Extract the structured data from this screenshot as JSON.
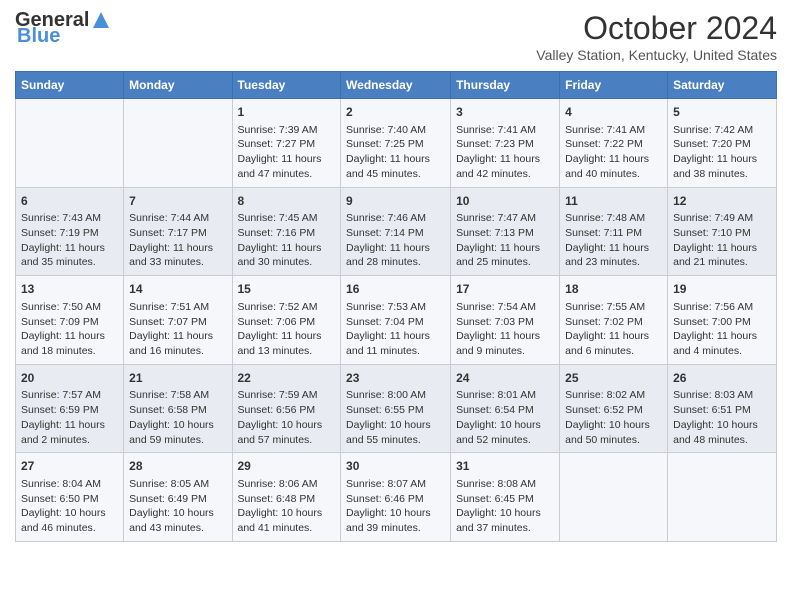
{
  "logo": {
    "part1": "General",
    "part2": "Blue"
  },
  "title": "October 2024",
  "subtitle": "Valley Station, Kentucky, United States",
  "days_of_week": [
    "Sunday",
    "Monday",
    "Tuesday",
    "Wednesday",
    "Thursday",
    "Friday",
    "Saturday"
  ],
  "weeks": [
    [
      {
        "day": "",
        "content": ""
      },
      {
        "day": "",
        "content": ""
      },
      {
        "day": "1",
        "content": "Sunrise: 7:39 AM\nSunset: 7:27 PM\nDaylight: 11 hours and 47 minutes."
      },
      {
        "day": "2",
        "content": "Sunrise: 7:40 AM\nSunset: 7:25 PM\nDaylight: 11 hours and 45 minutes."
      },
      {
        "day": "3",
        "content": "Sunrise: 7:41 AM\nSunset: 7:23 PM\nDaylight: 11 hours and 42 minutes."
      },
      {
        "day": "4",
        "content": "Sunrise: 7:41 AM\nSunset: 7:22 PM\nDaylight: 11 hours and 40 minutes."
      },
      {
        "day": "5",
        "content": "Sunrise: 7:42 AM\nSunset: 7:20 PM\nDaylight: 11 hours and 38 minutes."
      }
    ],
    [
      {
        "day": "6",
        "content": "Sunrise: 7:43 AM\nSunset: 7:19 PM\nDaylight: 11 hours and 35 minutes."
      },
      {
        "day": "7",
        "content": "Sunrise: 7:44 AM\nSunset: 7:17 PM\nDaylight: 11 hours and 33 minutes."
      },
      {
        "day": "8",
        "content": "Sunrise: 7:45 AM\nSunset: 7:16 PM\nDaylight: 11 hours and 30 minutes."
      },
      {
        "day": "9",
        "content": "Sunrise: 7:46 AM\nSunset: 7:14 PM\nDaylight: 11 hours and 28 minutes."
      },
      {
        "day": "10",
        "content": "Sunrise: 7:47 AM\nSunset: 7:13 PM\nDaylight: 11 hours and 25 minutes."
      },
      {
        "day": "11",
        "content": "Sunrise: 7:48 AM\nSunset: 7:11 PM\nDaylight: 11 hours and 23 minutes."
      },
      {
        "day": "12",
        "content": "Sunrise: 7:49 AM\nSunset: 7:10 PM\nDaylight: 11 hours and 21 minutes."
      }
    ],
    [
      {
        "day": "13",
        "content": "Sunrise: 7:50 AM\nSunset: 7:09 PM\nDaylight: 11 hours and 18 minutes."
      },
      {
        "day": "14",
        "content": "Sunrise: 7:51 AM\nSunset: 7:07 PM\nDaylight: 11 hours and 16 minutes."
      },
      {
        "day": "15",
        "content": "Sunrise: 7:52 AM\nSunset: 7:06 PM\nDaylight: 11 hours and 13 minutes."
      },
      {
        "day": "16",
        "content": "Sunrise: 7:53 AM\nSunset: 7:04 PM\nDaylight: 11 hours and 11 minutes."
      },
      {
        "day": "17",
        "content": "Sunrise: 7:54 AM\nSunset: 7:03 PM\nDaylight: 11 hours and 9 minutes."
      },
      {
        "day": "18",
        "content": "Sunrise: 7:55 AM\nSunset: 7:02 PM\nDaylight: 11 hours and 6 minutes."
      },
      {
        "day": "19",
        "content": "Sunrise: 7:56 AM\nSunset: 7:00 PM\nDaylight: 11 hours and 4 minutes."
      }
    ],
    [
      {
        "day": "20",
        "content": "Sunrise: 7:57 AM\nSunset: 6:59 PM\nDaylight: 11 hours and 2 minutes."
      },
      {
        "day": "21",
        "content": "Sunrise: 7:58 AM\nSunset: 6:58 PM\nDaylight: 10 hours and 59 minutes."
      },
      {
        "day": "22",
        "content": "Sunrise: 7:59 AM\nSunset: 6:56 PM\nDaylight: 10 hours and 57 minutes."
      },
      {
        "day": "23",
        "content": "Sunrise: 8:00 AM\nSunset: 6:55 PM\nDaylight: 10 hours and 55 minutes."
      },
      {
        "day": "24",
        "content": "Sunrise: 8:01 AM\nSunset: 6:54 PM\nDaylight: 10 hours and 52 minutes."
      },
      {
        "day": "25",
        "content": "Sunrise: 8:02 AM\nSunset: 6:52 PM\nDaylight: 10 hours and 50 minutes."
      },
      {
        "day": "26",
        "content": "Sunrise: 8:03 AM\nSunset: 6:51 PM\nDaylight: 10 hours and 48 minutes."
      }
    ],
    [
      {
        "day": "27",
        "content": "Sunrise: 8:04 AM\nSunset: 6:50 PM\nDaylight: 10 hours and 46 minutes."
      },
      {
        "day": "28",
        "content": "Sunrise: 8:05 AM\nSunset: 6:49 PM\nDaylight: 10 hours and 43 minutes."
      },
      {
        "day": "29",
        "content": "Sunrise: 8:06 AM\nSunset: 6:48 PM\nDaylight: 10 hours and 41 minutes."
      },
      {
        "day": "30",
        "content": "Sunrise: 8:07 AM\nSunset: 6:46 PM\nDaylight: 10 hours and 39 minutes."
      },
      {
        "day": "31",
        "content": "Sunrise: 8:08 AM\nSunset: 6:45 PM\nDaylight: 10 hours and 37 minutes."
      },
      {
        "day": "",
        "content": ""
      },
      {
        "day": "",
        "content": ""
      }
    ]
  ]
}
